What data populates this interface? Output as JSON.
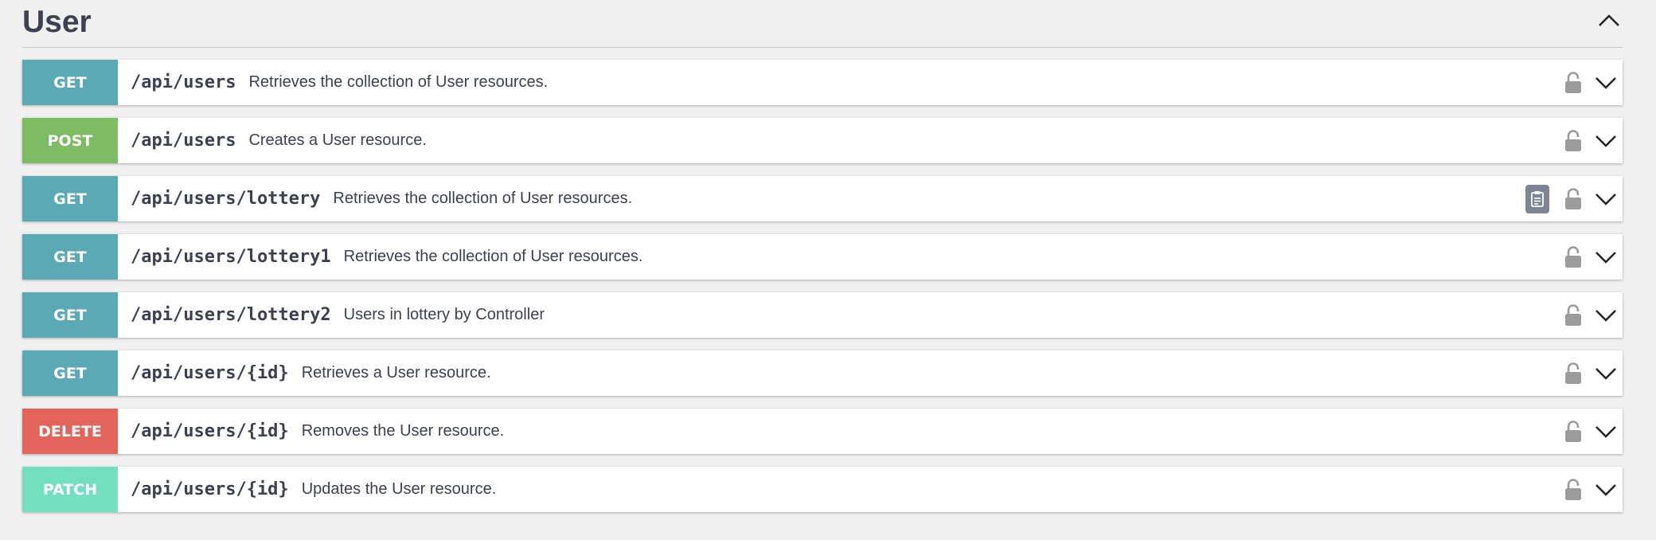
{
  "section": {
    "title": "User",
    "collapse_icon": "chevron-up-icon"
  },
  "colors": {
    "get": "#5ba9b5",
    "post": "#7dbb64",
    "delete": "#e2655b",
    "patch": "#73dfbf",
    "lock": "#9b9b9b",
    "copy": "#7d8492"
  },
  "operations": [
    {
      "method": "GET",
      "path": "/api/users",
      "summary": "Retrieves the collection of User resources.",
      "color": "#5ba9b5",
      "copy_button": false
    },
    {
      "method": "POST",
      "path": "/api/users",
      "summary": "Creates a User resource.",
      "color": "#7dbb64",
      "copy_button": false
    },
    {
      "method": "GET",
      "path": "/api/users/lottery",
      "summary": "Retrieves the collection of User resources.",
      "color": "#5ba9b5",
      "copy_button": true
    },
    {
      "method": "GET",
      "path": "/api/users/lottery1",
      "summary": "Retrieves the collection of User resources.",
      "color": "#5ba9b5",
      "copy_button": false
    },
    {
      "method": "GET",
      "path": "/api/users/lottery2",
      "summary": "Users in lottery by Controller",
      "color": "#5ba9b5",
      "copy_button": false
    },
    {
      "method": "GET",
      "path": "/api/users/{id}",
      "summary": "Retrieves a User resource.",
      "color": "#5ba9b5",
      "copy_button": false
    },
    {
      "method": "DELETE",
      "path": "/api/users/{id}",
      "summary": "Removes the User resource.",
      "color": "#e2655b",
      "copy_button": false
    },
    {
      "method": "PATCH",
      "path": "/api/users/{id}",
      "summary": "Updates the User resource.",
      "color": "#73dfbf",
      "copy_button": false
    }
  ]
}
